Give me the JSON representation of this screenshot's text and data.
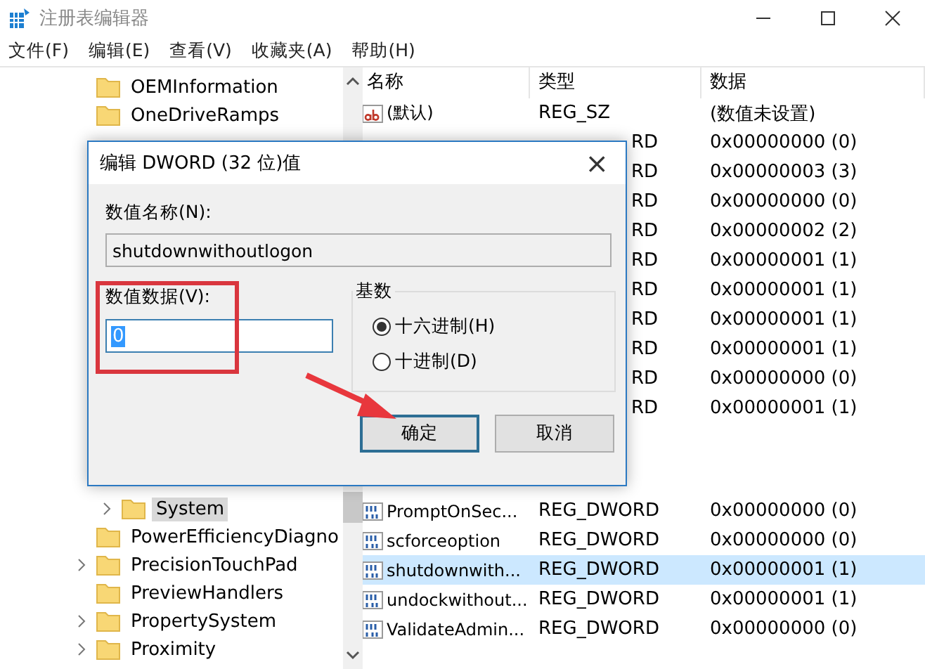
{
  "window": {
    "title": "注册表编辑器"
  },
  "menu": [
    "文件(F)",
    "编辑(E)",
    "查看(V)",
    "收藏夹(A)",
    "帮助(H)"
  ],
  "tree": {
    "items_top": [
      {
        "label": "OEMInformation",
        "expandable": false,
        "selected": false,
        "nested": false
      },
      {
        "label": "OneDriveRamps",
        "expandable": false,
        "selected": false,
        "nested": false
      }
    ],
    "items_bottom": [
      {
        "label": "System",
        "expandable": true,
        "selected": true,
        "nested": true
      },
      {
        "label": "PowerEfficiencyDiagno",
        "expandable": false,
        "selected": false,
        "nested": false
      },
      {
        "label": "PrecisionTouchPad",
        "expandable": true,
        "selected": false,
        "nested": false
      },
      {
        "label": "PreviewHandlers",
        "expandable": false,
        "selected": false,
        "nested": false
      },
      {
        "label": "PropertySystem",
        "expandable": true,
        "selected": false,
        "nested": false
      },
      {
        "label": "Proximity",
        "expandable": true,
        "selected": false,
        "nested": false
      }
    ]
  },
  "list": {
    "columns": [
      "名称",
      "类型",
      "数据"
    ],
    "rows_upper": [
      {
        "kind": "string",
        "name": "(默认)",
        "type": "REG_SZ",
        "data": "(数值未设置)",
        "selected": false
      },
      {
        "kind": "covered",
        "type": "RD",
        "data": "0x00000000 (0)",
        "selected": false
      },
      {
        "kind": "covered",
        "type": "RD",
        "data": "0x00000003 (3)",
        "selected": false
      },
      {
        "kind": "covered",
        "type": "RD",
        "data": "0x00000000 (0)",
        "selected": false
      },
      {
        "kind": "covered",
        "type": "RD",
        "data": "0x00000002 (2)",
        "selected": false
      },
      {
        "kind": "covered",
        "type": "RD",
        "data": "0x00000001 (1)",
        "selected": false
      },
      {
        "kind": "covered",
        "type": "RD",
        "data": "0x00000001 (1)",
        "selected": false
      },
      {
        "kind": "covered",
        "type": "RD",
        "data": "0x00000001 (1)",
        "selected": false
      },
      {
        "kind": "covered",
        "type": "RD",
        "data": "0x00000001 (1)",
        "selected": false
      },
      {
        "kind": "covered",
        "type": "RD",
        "data": "0x00000000 (0)",
        "selected": false
      },
      {
        "kind": "covered",
        "type": "RD",
        "data": "0x00000001 (1)",
        "selected": false
      }
    ],
    "rows_lower": [
      {
        "kind": "dword",
        "name": "PromptOnSec...",
        "type": "REG_DWORD",
        "data": "0x00000000 (0)",
        "selected": false
      },
      {
        "kind": "dword",
        "name": "scforceoption",
        "type": "REG_DWORD",
        "data": "0x00000000 (0)",
        "selected": false
      },
      {
        "kind": "dword",
        "name": "shutdownwith...",
        "type": "REG_DWORD",
        "data": "0x00000001 (1)",
        "selected": true
      },
      {
        "kind": "dword",
        "name": "undockwithout...",
        "type": "REG_DWORD",
        "data": "0x00000001 (1)",
        "selected": false
      },
      {
        "kind": "dword",
        "name": "ValidateAdmin...",
        "type": "REG_DWORD",
        "data": "0x00000000 (0)",
        "selected": false
      }
    ]
  },
  "dialog": {
    "title": "编辑 DWORD (32 位)值",
    "close": "×",
    "name_label": "数值名称(N):",
    "name_value": "shutdownwithoutlogon",
    "data_label": "数值数据(V):",
    "data_value": "0",
    "base_label": "基数",
    "bases": [
      {
        "label": "十六进制(H)",
        "selected": true
      },
      {
        "label": "十进制(D)",
        "selected": false
      }
    ],
    "buttons": [
      {
        "label": "确定",
        "focused": true
      },
      {
        "label": "取消",
        "focused": false
      }
    ]
  }
}
